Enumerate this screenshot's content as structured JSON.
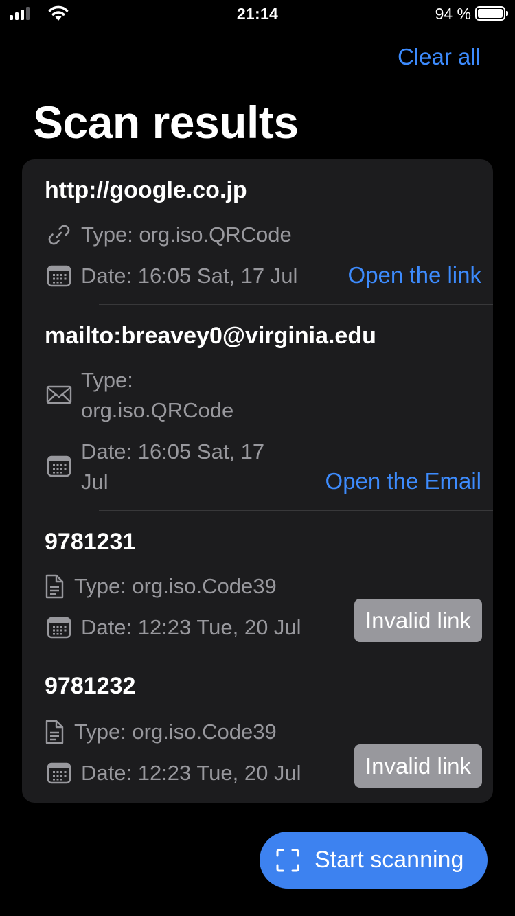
{
  "status_bar": {
    "time": "21:14",
    "battery_percent": "94 %",
    "signal_bars": 3,
    "battery_level": 0.94
  },
  "header": {
    "clear_all": "Clear all",
    "title": "Scan results"
  },
  "results": [
    {
      "content": "http://google.co.jp",
      "type_text": "Type: org.iso.QRCode",
      "type_icon": "link-icon",
      "date_text": "Date: 16:05 Sat, 17 Jul",
      "action": "Open the link"
    },
    {
      "content": "mailto:breavey0@virginia.edu",
      "type_text": "Type:\norg.iso.QRCode",
      "type_icon": "mail-icon",
      "date_text": "Date: 16:05 Sat, 17\nJul",
      "action": "Open the Email"
    },
    {
      "content": "9781231",
      "type_text": "Type: org.iso.Code39",
      "type_icon": "document-icon",
      "date_text": "Date: 12:23 Tue, 20 Jul",
      "action": "Invalid link"
    },
    {
      "content": "9781232",
      "type_text": "Type: org.iso.Code39",
      "type_icon": "document-icon",
      "date_text": "Date: 12:23 Tue, 20 Jul",
      "action": "Invalid link"
    }
  ],
  "start_scanning": "Start scanning",
  "colors": {
    "accent": "#3d8bfd",
    "card": "#1c1c1e",
    "secondary_text": "#98989d",
    "invalid_button": "#98989d"
  }
}
